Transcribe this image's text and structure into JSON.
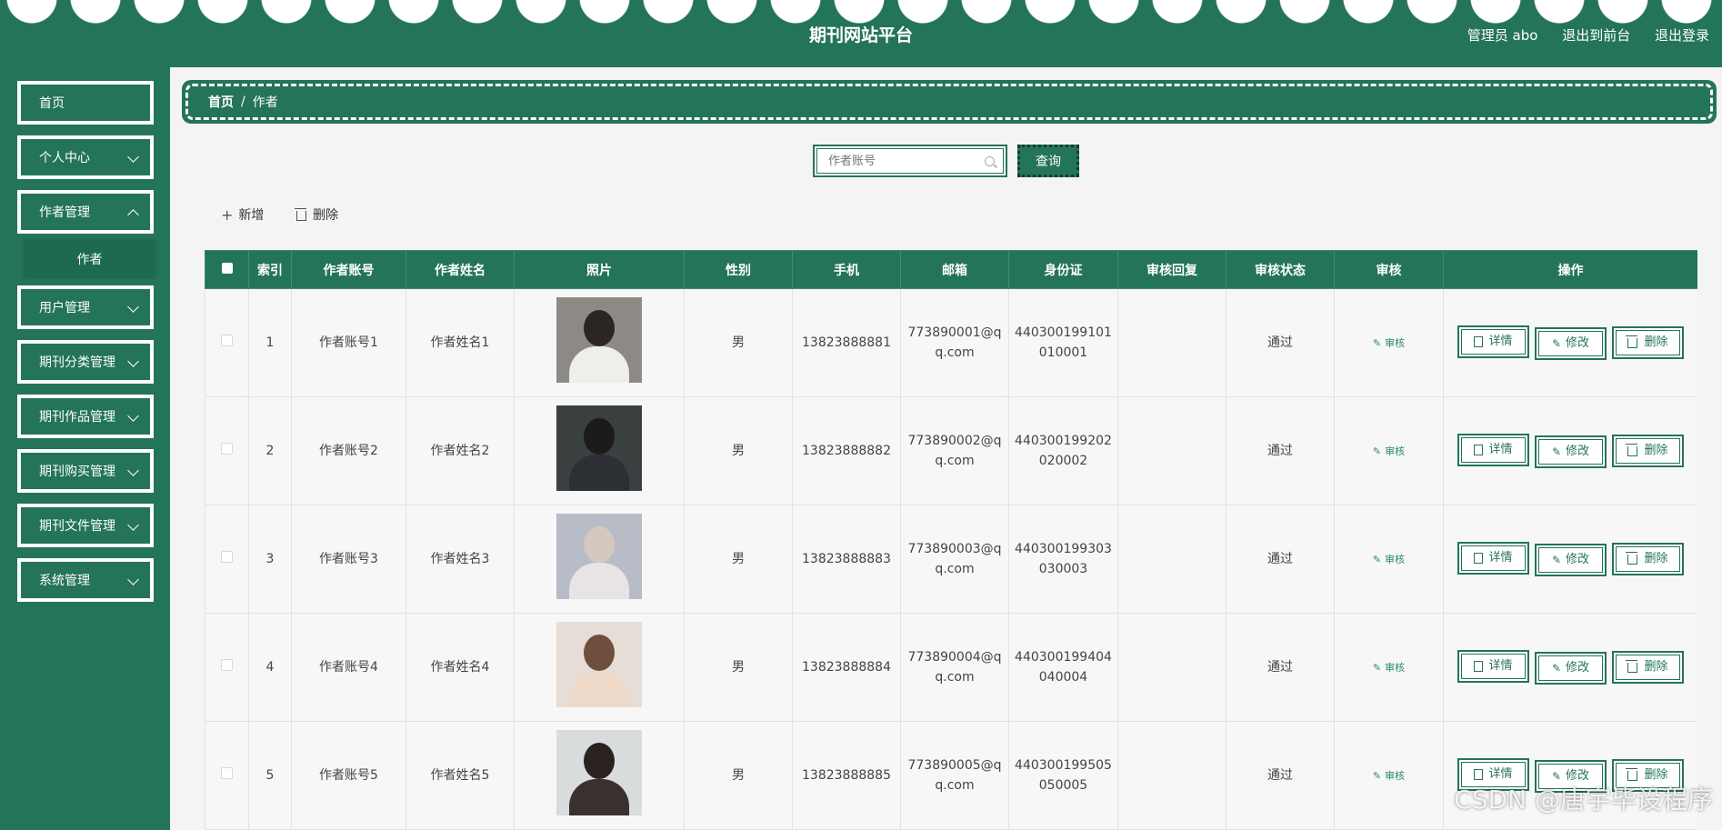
{
  "header": {
    "title": "期刊网站平台",
    "admin_label": "管理员 abo",
    "front_link": "退出到前台",
    "logout_link": "退出登录"
  },
  "sidebar": {
    "items": [
      {
        "label": "首页"
      },
      {
        "label": "个人中心"
      },
      {
        "label": "作者管理"
      },
      {
        "label": "用户管理"
      },
      {
        "label": "期刊分类管理"
      },
      {
        "label": "期刊作品管理"
      },
      {
        "label": "期刊购买管理"
      },
      {
        "label": "期刊文件管理"
      },
      {
        "label": "系统管理"
      }
    ],
    "active_submenu": "作者"
  },
  "breadcrumb": {
    "home": "首页",
    "separator": "/",
    "current": "作者"
  },
  "search": {
    "placeholder": "作者账号",
    "button": "查询"
  },
  "actions": {
    "add": "新增",
    "delete": "删除"
  },
  "table": {
    "headers": [
      "",
      "索引",
      "作者账号",
      "作者姓名",
      "照片",
      "性别",
      "手机",
      "邮箱",
      "身份证",
      "审核回复",
      "审核状态",
      "审核",
      "操作"
    ],
    "audit_label": "审核",
    "btn_detail": "详情",
    "btn_edit": "修改",
    "btn_delete": "删除",
    "rows": [
      {
        "index": "1",
        "account": "作者账号1",
        "name": "作者姓名1",
        "gender": "男",
        "phone": "13823888881",
        "email": "773890001@qq.com",
        "id_card": "440300199101010001",
        "reply": "",
        "status": "通过"
      },
      {
        "index": "2",
        "account": "作者账号2",
        "name": "作者姓名2",
        "gender": "男",
        "phone": "13823888882",
        "email": "773890002@qq.com",
        "id_card": "440300199202020002",
        "reply": "",
        "status": "通过"
      },
      {
        "index": "3",
        "account": "作者账号3",
        "name": "作者姓名3",
        "gender": "男",
        "phone": "13823888883",
        "email": "773890003@qq.com",
        "id_card": "440300199303030003",
        "reply": "",
        "status": "通过"
      },
      {
        "index": "4",
        "account": "作者账号4",
        "name": "作者姓名4",
        "gender": "男",
        "phone": "13823888884",
        "email": "773890004@qq.com",
        "id_card": "440300199404040004",
        "reply": "",
        "status": "通过"
      },
      {
        "index": "5",
        "account": "作者账号5",
        "name": "作者姓名5",
        "gender": "男",
        "phone": "13823888885",
        "email": "773890005@qq.com",
        "id_card": "440300199505050005",
        "reply": "",
        "status": "通过"
      }
    ]
  },
  "colors": {
    "primary": "#247459",
    "background": "#f4f4f4"
  },
  "watermark": "CSDN @唐宇毕设程序"
}
